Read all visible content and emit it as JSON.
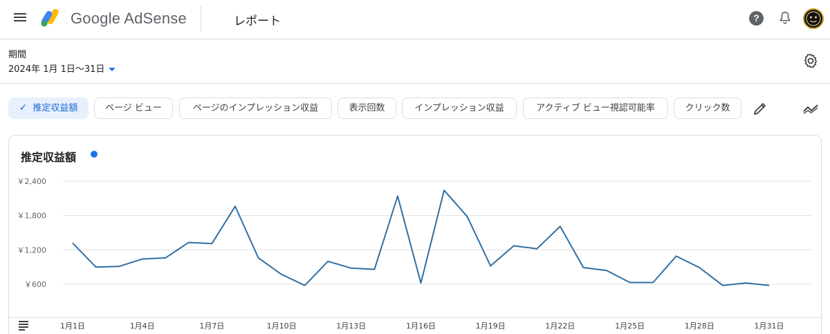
{
  "header": {
    "brand": "Google AdSense",
    "page_title": "レポート",
    "help_glyph": "?"
  },
  "date": {
    "label": "期間",
    "range": "2024年 1月 1日〜31日"
  },
  "chips": [
    {
      "label": "推定収益額",
      "selected": true
    },
    {
      "label": "ページ ビュー",
      "selected": false
    },
    {
      "label": "ページのインプレッション収益",
      "selected": false
    },
    {
      "label": "表示回数",
      "selected": false
    },
    {
      "label": "インプレッション収益",
      "selected": false
    },
    {
      "label": "アクティブ ビュー視認可能率",
      "selected": false
    },
    {
      "label": "クリック数",
      "selected": false
    }
  ],
  "icons": {
    "menu": "menu-icon",
    "help": "help-icon",
    "notifications": "bell-icon",
    "settings": "gear-icon",
    "edit": "pencil-icon",
    "trend": "trend-icon",
    "table": "table-icon"
  },
  "colors": {
    "accent": "#1a73e8",
    "line": "#2f6ea3",
    "chip_selected_bg": "#e8f0fe"
  },
  "chart_data": {
    "type": "line",
    "title": "推定収益額",
    "xlabel": "",
    "ylabel": "",
    "ylim": [
      600,
      2400
    ],
    "yticks": [
      "￥2,400",
      "￥1,800",
      "￥1,200",
      "￥600"
    ],
    "ytick_values": [
      2400,
      1800,
      1200,
      600
    ],
    "xticks": [
      "1月1日",
      "1月4日",
      "1月7日",
      "1月10日",
      "1月13日",
      "1月16日",
      "1月19日",
      "1月22日",
      "1月25日",
      "1月28日",
      "1月31日"
    ],
    "xtick_days": [
      1,
      4,
      7,
      10,
      13,
      16,
      19,
      22,
      25,
      28,
      31
    ],
    "x": [
      1,
      2,
      3,
      4,
      5,
      6,
      7,
      8,
      9,
      10,
      11,
      12,
      13,
      14,
      15,
      16,
      17,
      18,
      19,
      20,
      21,
      22,
      23,
      24,
      25,
      26,
      27,
      28,
      29,
      30,
      31
    ],
    "values": [
      1320,
      900,
      910,
      1040,
      1060,
      1330,
      1310,
      1960,
      1060,
      770,
      580,
      1000,
      880,
      860,
      2140,
      620,
      2240,
      1780,
      920,
      1270,
      1220,
      1610,
      890,
      840,
      630,
      630,
      1090,
      890,
      580,
      620,
      580
    ],
    "grid": true,
    "legend": "top-left"
  }
}
